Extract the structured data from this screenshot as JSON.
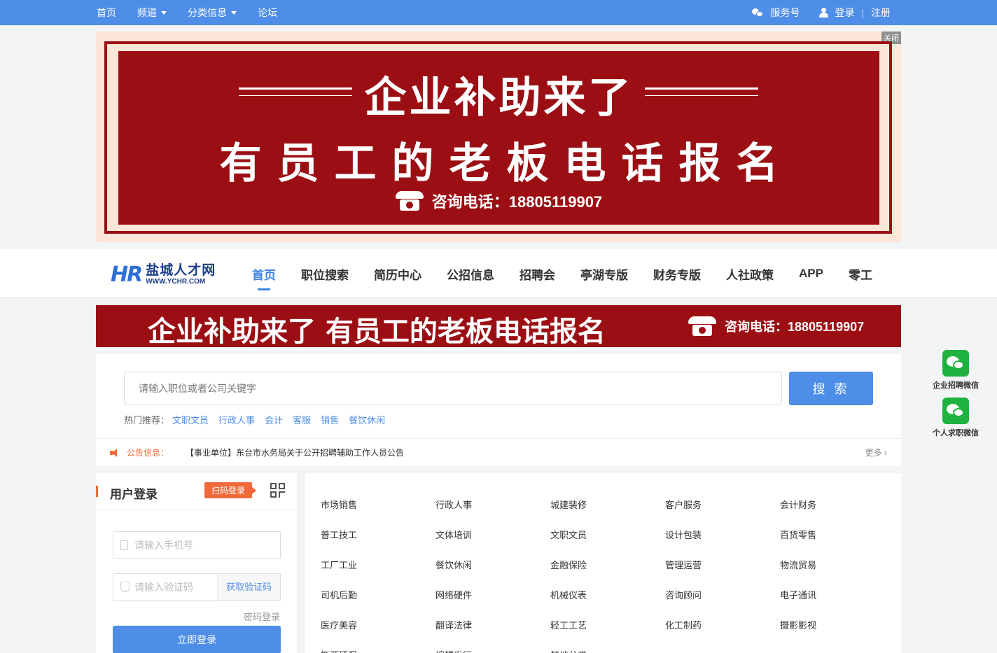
{
  "topbar": {
    "nav": [
      "首页",
      "频道",
      "分类信息",
      "论坛"
    ],
    "service": "服务号",
    "login": "登录",
    "register": "注册"
  },
  "big_banner": {
    "close": "关闭",
    "title": "企业补助来了",
    "subtitle": "有员工的老板电话报名",
    "phone": "咨询电话：18805119907"
  },
  "logo": {
    "cn": "盐城人才网",
    "en": "WWW.YCHR.COM",
    "mark": "HR"
  },
  "main_nav": [
    "首页",
    "职位搜索",
    "简历中心",
    "公招信息",
    "招聘会",
    "亭湖专版",
    "财务专版",
    "人社政策",
    "APP",
    "零工"
  ],
  "small_banner": {
    "text": "企业补助来了 有员工的老板电话报名",
    "phone": "咨询电话：18805119907"
  },
  "search": {
    "placeholder": "请输入职位或者公司关键字",
    "button": "搜 索",
    "hot_label": "热门推荐：",
    "hot": [
      "文职文员",
      "行政人事",
      "会计",
      "客服",
      "销售",
      "餐饮休闲"
    ]
  },
  "notice": {
    "label": "公告信息：",
    "message": "【事业单位】东台市水务局关于公开招聘辅助工作人员公告",
    "more": "更多 ›"
  },
  "login": {
    "title": "用户登录",
    "qr_tag": "扫码登录",
    "phone_placeholder": "请输入手机号",
    "code_placeholder": "请输入验证码",
    "get_code": "获取验证码",
    "password_login": "密码登录",
    "submit": "立即登录"
  },
  "categories": [
    "市场销售",
    "行政人事",
    "城建装修",
    "客户服务",
    "会计财务",
    "普工技工",
    "文体培训",
    "文职文员",
    "设计包装",
    "百货零售",
    "工厂工业",
    "餐饮休闲",
    "金融保险",
    "管理运营",
    "物流贸易",
    "司机后勤",
    "网络硬件",
    "机械仪表",
    "咨询顾问",
    "电子通讯",
    "医疗美容",
    "翻译法律",
    "轻工工艺",
    "化工制药",
    "摄影影视",
    "能源环保",
    "编辑发行",
    "其他分类"
  ],
  "side": {
    "company_wechat": "企业招聘微信",
    "personal_wechat": "个人求职微信"
  }
}
